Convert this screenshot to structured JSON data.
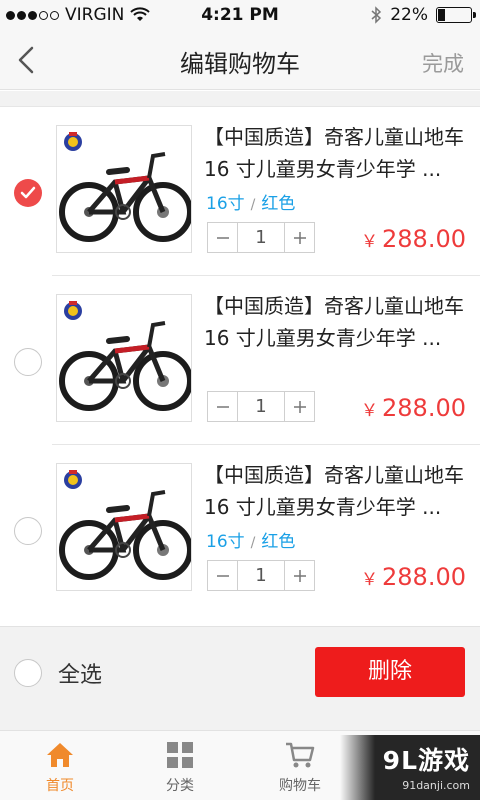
{
  "status_bar": {
    "carrier": "VIRGIN",
    "time": "4:21 PM",
    "battery": "22%",
    "battery_level": 0.22
  },
  "nav": {
    "title": "编辑购物车",
    "done_label": "完成"
  },
  "items": [
    {
      "title_line1": "【中国质造】奇客儿童山地车",
      "title_line2": "16 寸儿童男女青少年学 ...",
      "size": "16寸",
      "color": "红色",
      "quantity": "1",
      "price": "288.00",
      "currency": "￥",
      "selected": true
    },
    {
      "title_line1": "【中国质造】奇客儿童山地车",
      "title_line2": "16 寸儿童男女青少年学 ...",
      "quantity": "1",
      "price": "288.00",
      "currency": "￥",
      "selected": false
    },
    {
      "title_line1": "【中国质造】奇客儿童山地车",
      "title_line2": "16 寸儿童男女青少年学 ...",
      "size": "16寸",
      "color": "红色",
      "quantity": "1",
      "price": "288.00",
      "currency": "￥",
      "selected": false
    }
  ],
  "action_bar": {
    "select_all_label": "全选",
    "delete_label": "删除"
  },
  "tabs": [
    {
      "label": "首页",
      "icon": "home-icon",
      "active": true
    },
    {
      "label": "分类",
      "icon": "grid-icon",
      "active": false
    },
    {
      "label": "购物车",
      "icon": "cart-icon",
      "active": false
    }
  ],
  "watermark": {
    "main": "9L游戏",
    "sub": "91danji.com"
  },
  "colors": {
    "accent_red": "#ee3b3b",
    "delete_red": "#ee1c1c",
    "variant_blue": "#1aa0e6",
    "tab_active": "#f08a2c"
  }
}
